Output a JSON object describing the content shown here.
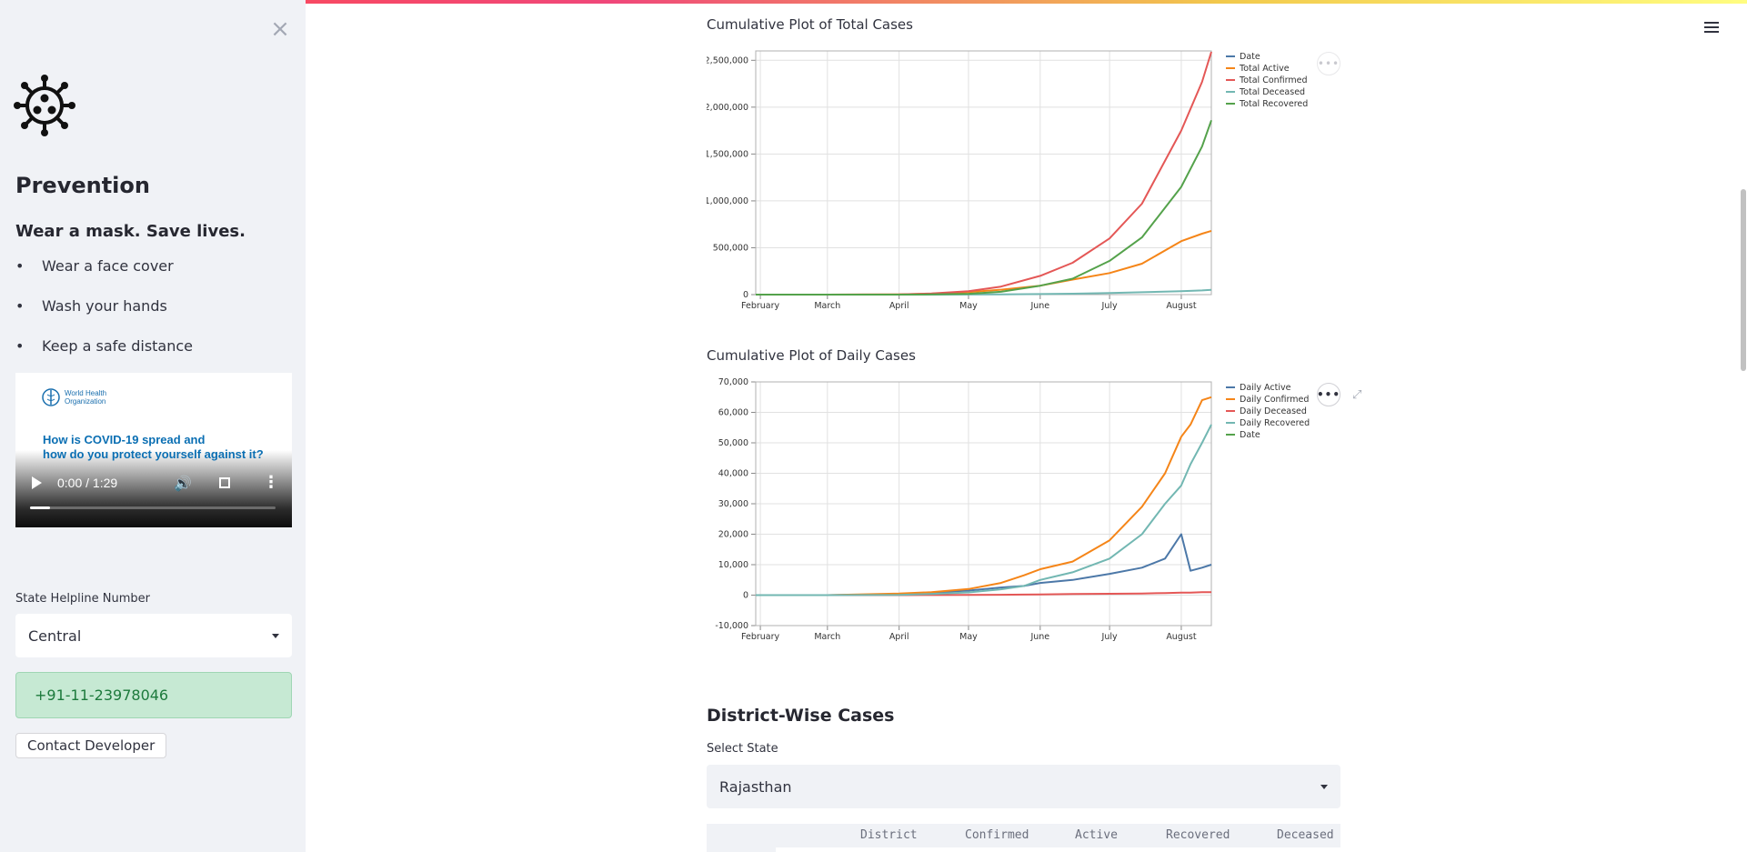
{
  "sidebar": {
    "close_label": "×",
    "title": "Prevention",
    "subtitle": "Wear a mask. Save lives.",
    "tips": [
      "Wear a face cover",
      "Wash your hands",
      "Keep a safe distance"
    ],
    "video": {
      "org_line1": "World Health",
      "org_line2": "Organization",
      "caption_line1": "How is COVID-19 spread and",
      "caption_line2": "how do you protect yourself against it?",
      "time": "0:00 / 1:29",
      "progress": 0.08
    },
    "helpline_label": "State Helpline Number",
    "helpline_state": "Central",
    "helpline_number": "+91-11-23978046",
    "contact_button": "Contact Developer"
  },
  "main": {
    "chart1_title": "Cumulative Plot of Total Cases",
    "chart2_title": "Cumulative Plot of Daily Cases",
    "section_title": "District-Wise Cases",
    "select_label": "Select State",
    "selected_state": "Rajasthan",
    "table_columns": [
      "District",
      "Confirmed",
      "Active",
      "Recovered",
      "Deceased"
    ]
  },
  "chart_data": [
    {
      "type": "line",
      "title": "Cumulative Plot of Total Cases",
      "x_ticks": [
        "February",
        "March",
        "April",
        "May",
        "June",
        "July",
        "August"
      ],
      "y_ticks": [
        "0",
        "500,000",
        "1,000,000",
        "1,500,000",
        "2,000,000",
        "2,500,000"
      ],
      "ylim": [
        0,
        2600000
      ],
      "x": [
        "2020-01-30",
        "2020-03-01",
        "2020-04-01",
        "2020-04-15",
        "2020-05-01",
        "2020-05-15",
        "2020-06-01",
        "2020-06-15",
        "2020-07-01",
        "2020-07-15",
        "2020-08-01",
        "2020-08-10",
        "2020-08-14"
      ],
      "legend": [
        "Date",
        "Total Active",
        "Total Confirmed",
        "Total Deceased",
        "Total Recovered"
      ],
      "series": [
        {
          "name": "Total Active",
          "color": "#f58518",
          "values": [
            0,
            0,
            1500,
            10000,
            27000,
            52000,
            95000,
            160000,
            230000,
            330000,
            570000,
            650000,
            680000
          ]
        },
        {
          "name": "Total Confirmed",
          "color": "#e45756",
          "values": [
            0,
            3,
            1600,
            12000,
            37000,
            85000,
            200000,
            340000,
            600000,
            970000,
            1750000,
            2270000,
            2590000
          ]
        },
        {
          "name": "Total Deceased",
          "color": "#72b7b2",
          "values": [
            0,
            0,
            40,
            400,
            1200,
            2800,
            5600,
            9900,
            17000,
            25000,
            37000,
            45000,
            50000
          ]
        },
        {
          "name": "Total Recovered",
          "color": "#54a24b",
          "values": [
            0,
            0,
            150,
            1500,
            9000,
            30000,
            95000,
            170000,
            360000,
            610000,
            1150000,
            1580000,
            1860000
          ]
        }
      ]
    },
    {
      "type": "line",
      "title": "Cumulative Plot of Daily Cases",
      "x_ticks": [
        "February",
        "March",
        "April",
        "May",
        "June",
        "July",
        "August"
      ],
      "y_ticks": [
        "-10,000",
        "0",
        "10,000",
        "20,000",
        "30,000",
        "40,000",
        "50,000",
        "60,000",
        "70,000"
      ],
      "ylim": [
        -10000,
        70000
      ],
      "x": [
        "2020-01-30",
        "2020-03-01",
        "2020-04-01",
        "2020-04-15",
        "2020-05-01",
        "2020-05-15",
        "2020-05-25",
        "2020-06-01",
        "2020-06-15",
        "2020-07-01",
        "2020-07-15",
        "2020-07-25",
        "2020-08-01",
        "2020-08-05",
        "2020-08-10",
        "2020-08-14"
      ],
      "legend": [
        "Daily Active",
        "Daily Confirmed",
        "Daily Deceased",
        "Daily Recovered",
        "Date"
      ],
      "series": [
        {
          "name": "Daily Active",
          "color": "#4c78a8",
          "values": [
            0,
            0,
            300,
            800,
            1500,
            2500,
            3000,
            4000,
            5000,
            7000,
            9000,
            12000,
            20000,
            8000,
            9000,
            10000
          ]
        },
        {
          "name": "Daily Confirmed",
          "color": "#f58518",
          "values": [
            0,
            0,
            500,
            1000,
            2000,
            4000,
            6500,
            8500,
            11000,
            18000,
            29000,
            40000,
            52000,
            56000,
            64000,
            65000
          ]
        },
        {
          "name": "Daily Deceased",
          "color": "#e45756",
          "values": [
            0,
            0,
            10,
            30,
            60,
            120,
            170,
            220,
            350,
            450,
            550,
            700,
            800,
            850,
            1000,
            1000
          ]
        },
        {
          "name": "Daily Recovered",
          "color": "#72b7b2",
          "values": [
            0,
            0,
            100,
            400,
            900,
            1900,
            3000,
            5000,
            7500,
            12000,
            20000,
            30000,
            36000,
            43000,
            50000,
            56000
          ]
        }
      ]
    }
  ]
}
